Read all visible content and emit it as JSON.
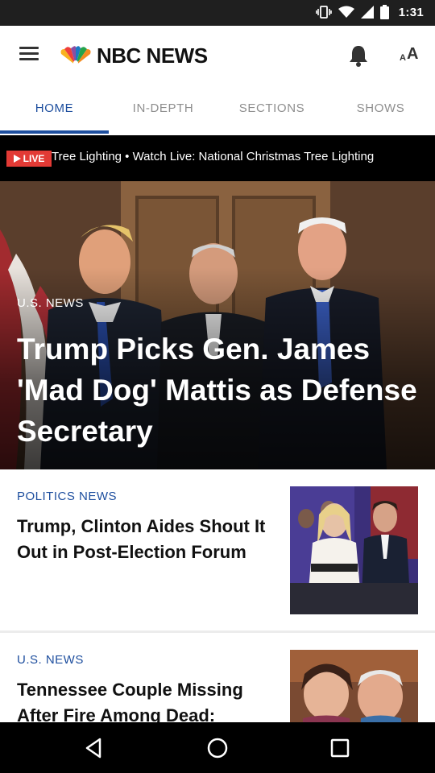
{
  "status_bar": {
    "time": "1:31",
    "icons": [
      "vibrate-icon",
      "wifi-icon",
      "signal-icon",
      "battery-icon"
    ]
  },
  "app_bar": {
    "menu_icon": "hamburger-menu-icon",
    "logo_text": "NBC NEWS",
    "logo_icon": "nbc-peacock-logo",
    "notification_icon": "bell-icon",
    "font_size_icon": "text-size-icon"
  },
  "tabs": [
    {
      "label": "HOME",
      "active": true
    },
    {
      "label": "IN-DEPTH",
      "active": false
    },
    {
      "label": "SECTIONS",
      "active": false
    },
    {
      "label": "SHOWS",
      "active": false
    }
  ],
  "live_bar": {
    "badge": "LIVE",
    "ticker_text": "Tree Lighting  •  Watch Live: National Christmas Tree Lighting"
  },
  "hero": {
    "kicker": "U.S. NEWS",
    "title": "Trump Picks Gen. James 'Mad Dog' Mattis as Defense Secretary"
  },
  "stories": [
    {
      "kicker": "POLITICS NEWS",
      "title": "Trump, Clinton Aides Shout It Out in Post-Election Forum"
    },
    {
      "kicker": "U.S. NEWS",
      "title": "Tennessee Couple Missing After Fire Among Dead:"
    }
  ],
  "colors": {
    "accent": "#1d4e9e",
    "live_red": "#e23a35",
    "status_bar": "#1f1f1f"
  },
  "nav_bar": {
    "back_icon": "back-triangle-icon",
    "home_icon": "home-circle-icon",
    "recents_icon": "recents-square-icon"
  }
}
